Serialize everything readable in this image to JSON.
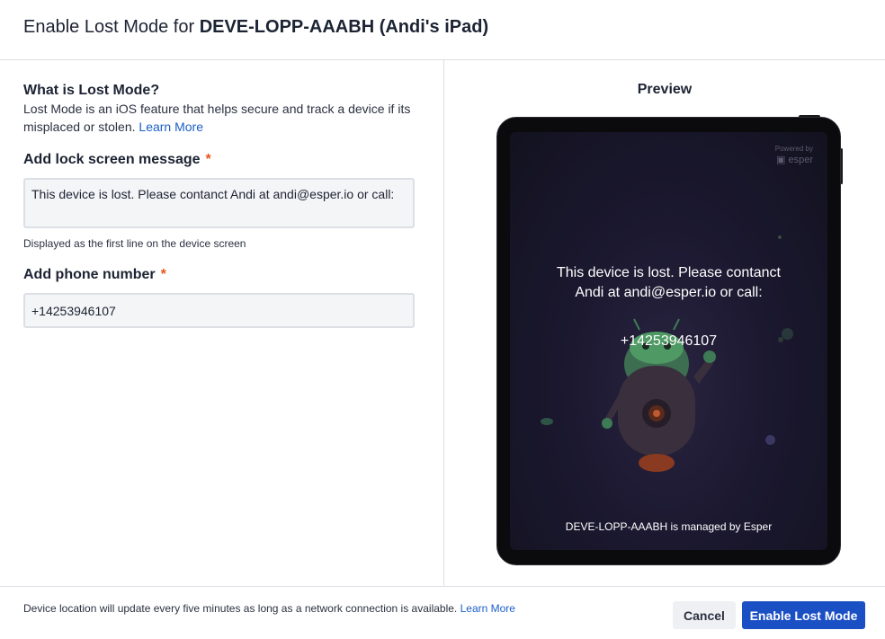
{
  "dialog": {
    "title_prefix": "Enable Lost Mode for ",
    "title_device": "DEVE-LOPP-AAABH (Andi's iPad)"
  },
  "info": {
    "heading": "What is Lost Mode?",
    "description": "Lost Mode is an iOS feature that helps secure and track a device if its misplaced or stolen. ",
    "learn_more": "Learn More"
  },
  "message_field": {
    "label": "Add lock screen message",
    "required_mark": "*",
    "value": "This device is lost. Please contanct Andi at andi@esper.io or call:",
    "hint": "Displayed as the first line on the device screen"
  },
  "phone_field": {
    "label": "Add phone number",
    "required_mark": "*",
    "value": "+14253946107"
  },
  "preview": {
    "label": "Preview",
    "powered_by": "Powered by",
    "brand": "esper",
    "message": "This device is lost. Please contanct Andi at andi@esper.io or call:",
    "phone": "+14253946107",
    "managed_text": "DEVE-LOPP-AAABH is managed by Esper"
  },
  "footer": {
    "note": "Device location will update every five minutes as long as a network connection is available. ",
    "learn_more": "Learn More",
    "cancel_label": "Cancel",
    "enable_label": "Enable Lost Mode"
  },
  "colors": {
    "primary_button": "#1b4fc4",
    "link": "#1b5fc8",
    "required": "#e5541b",
    "device_screen": "#1b1830"
  }
}
